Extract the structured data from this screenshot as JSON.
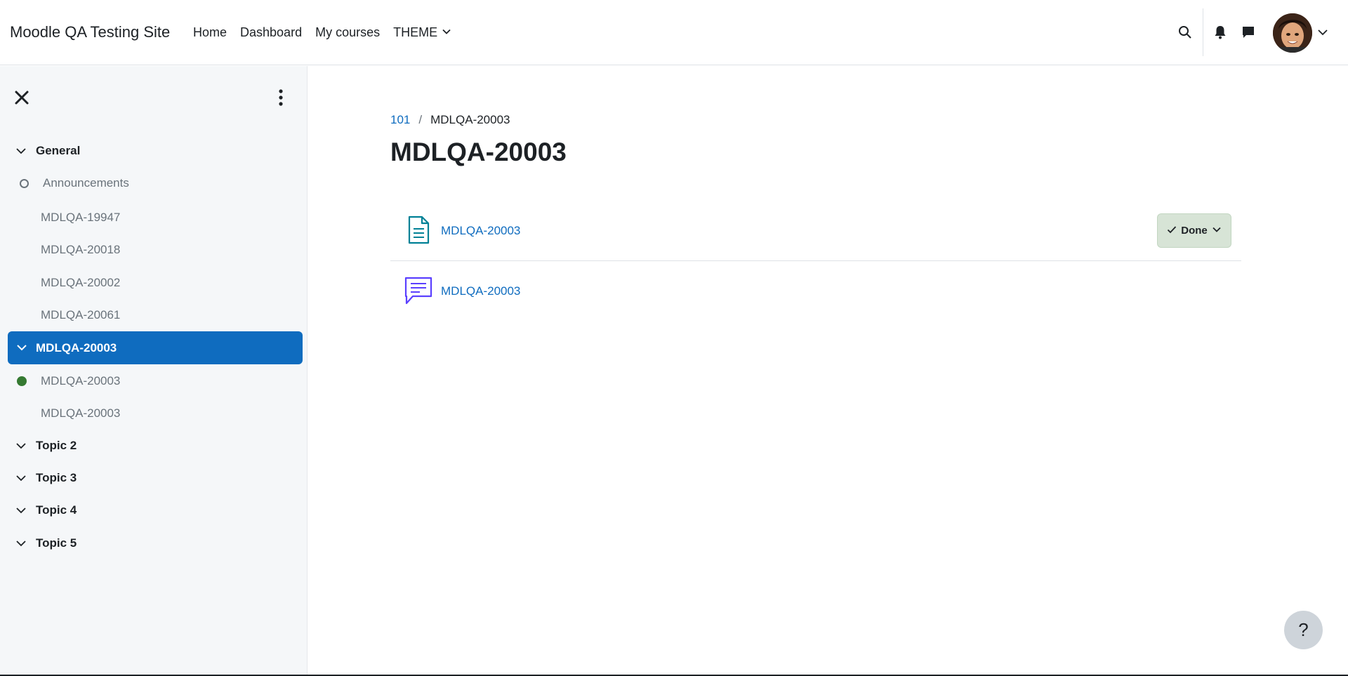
{
  "navbar": {
    "brand": "Moodle QA Testing Site",
    "links": [
      "Home",
      "Dashboard",
      "My courses",
      "THEME"
    ],
    "icons": [
      "search-icon",
      "bell-icon",
      "chat-icon",
      "avatar",
      "chevron-down-icon"
    ]
  },
  "sidebar": {
    "items": [
      {
        "type": "section",
        "label": "General"
      },
      {
        "type": "item",
        "label": "Announcements",
        "status": "incomplete"
      },
      {
        "type": "item",
        "label": "MDLQA-19947"
      },
      {
        "type": "item",
        "label": "MDLQA-20018"
      },
      {
        "type": "item",
        "label": "MDLQA-20002"
      },
      {
        "type": "item",
        "label": "MDLQA-20061"
      },
      {
        "type": "section",
        "label": "MDLQA-20003",
        "active": true
      },
      {
        "type": "item",
        "label": "MDLQA-20003",
        "status": "complete"
      },
      {
        "type": "item",
        "label": "MDLQA-20003"
      },
      {
        "type": "section",
        "label": "Topic 2"
      },
      {
        "type": "section",
        "label": "Topic 3"
      },
      {
        "type": "section",
        "label": "Topic 4"
      },
      {
        "type": "section",
        "label": "Topic 5"
      }
    ]
  },
  "breadcrumb": {
    "course": "101",
    "separator": "/",
    "current": "MDLQA-20003"
  },
  "page": {
    "title": "MDLQA-20003"
  },
  "activities": [
    {
      "name": "MDLQA-20003",
      "icon": "page-icon",
      "completion": "Done"
    },
    {
      "name": "MDLQA-20003",
      "icon": "forum-icon"
    }
  ],
  "help": {
    "label": "?"
  },
  "colors": {
    "primary": "#0f6cbf",
    "complete": "#357a32",
    "done_bg": "#d7e4d6",
    "page_icon": "#008196",
    "forum_icon": "#5b40ff"
  }
}
